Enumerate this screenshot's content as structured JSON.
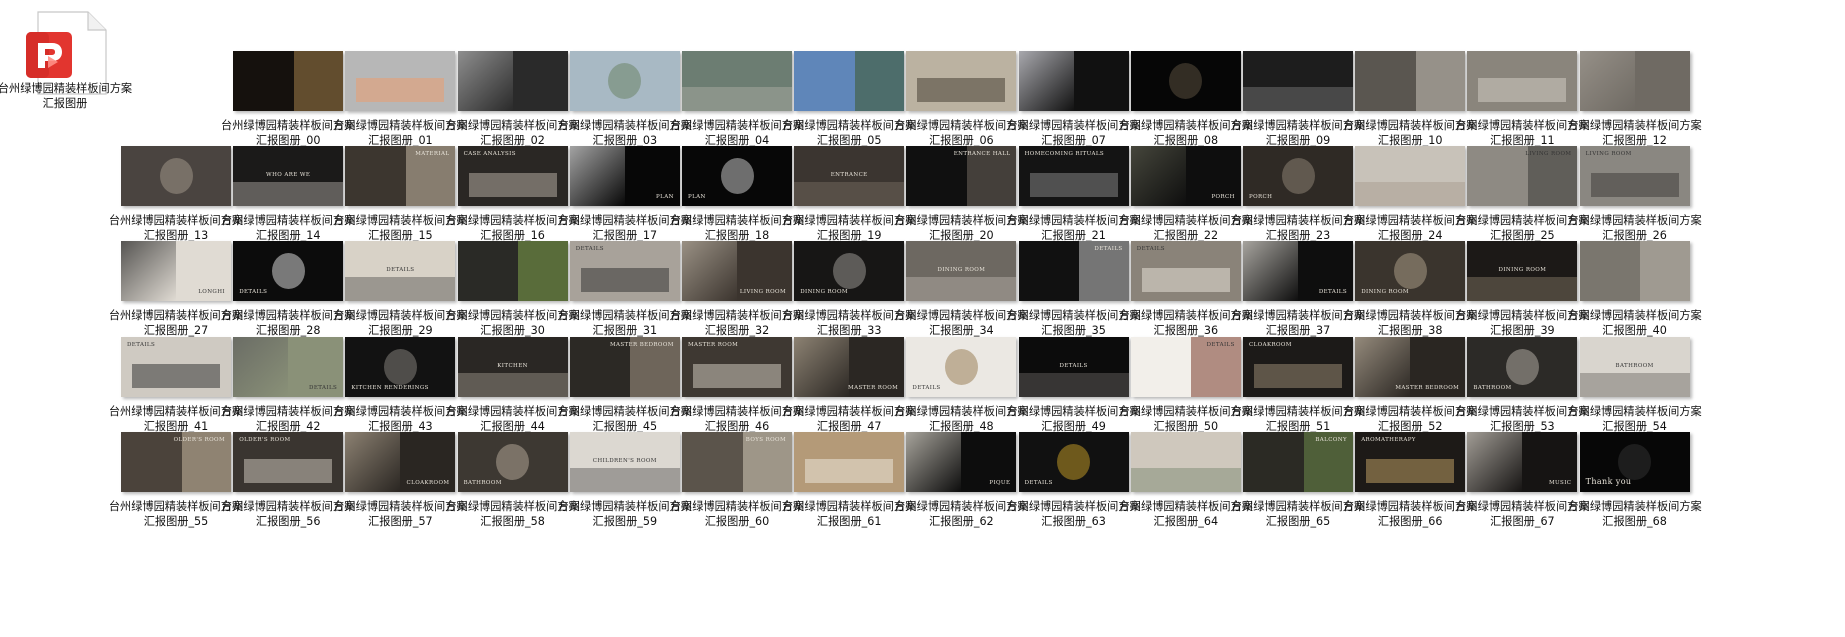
{
  "title_prefix": "台州绿博园精装样板间方案汇报图册",
  "file_item": {
    "label": "台州绿博园精装样板间方案汇报图册",
    "icon": "pdf-file-icon"
  },
  "items": [
    {
      "label": "台州绿博园精装样板间方案汇报图册_00",
      "bg": "#15110d",
      "accent": "#a37f4a",
      "text": "",
      "tone": "dark"
    },
    {
      "label": "台州绿博园精装样板间方案汇报图册_01",
      "bg": "#b7b7b7",
      "accent": "#f09b6a",
      "text": "",
      "tone": "light"
    },
    {
      "label": "台州绿博园精装样板间方案汇报图册_02",
      "bg": "#2a2a2a",
      "accent": "#b9b9b9",
      "text": "",
      "tone": "dark"
    },
    {
      "label": "台州绿博园精装样板间方案汇报图册_03",
      "bg": "#a8b9c4",
      "accent": "#5f7a54",
      "text": "",
      "tone": "light"
    },
    {
      "label": "台州绿博园精装样板间方案汇报图册_04",
      "bg": "#6c7d72",
      "accent": "#c7c1b6",
      "text": "",
      "tone": "light"
    },
    {
      "label": "台州绿博园精装样板间方案汇报图册_05",
      "bg": "#5f86b9",
      "accent": "#3e5a2c",
      "text": "",
      "tone": "light"
    },
    {
      "label": "台州绿博园精装样板间方案汇报图册_06",
      "bg": "#bbb2a1",
      "accent": "#3e352c",
      "text": "",
      "tone": "light"
    },
    {
      "label": "台州绿博园精装样板间方案汇报图册_07",
      "bg": "#111111",
      "accent": "#e9e9f0",
      "text": "",
      "tone": "dark"
    },
    {
      "label": "台州绿博园精装样板间方案汇报图册_08",
      "bg": "#060606",
      "accent": "#6b5e4a",
      "text": "",
      "tone": "dark"
    },
    {
      "label": "台州绿博园精装样板间方案汇报图册_09",
      "bg": "#1d1d1d",
      "accent": "#9a9a9a",
      "text": "",
      "tone": "dark"
    },
    {
      "label": "台州绿博园精装样板间方案汇报图册_10",
      "bg": "#5a5650",
      "accent": "#c9c3b8",
      "text": "",
      "tone": "dark"
    },
    {
      "label": "台州绿博园精装样板间方案汇报图册_11",
      "bg": "#8a857c",
      "accent": "#d6d1c8",
      "text": "",
      "tone": "light"
    },
    {
      "label": "台州绿博园精装样板间方案汇报图册_12",
      "bg": "#6f6a63",
      "accent": "#a6a097",
      "text": "",
      "tone": "light"
    },
    {
      "label": "台州绿博园精装样板间方案汇报图册_13",
      "bg": "#4a4440",
      "accent": "#b1a796",
      "text": "",
      "tone": "dark"
    },
    {
      "label": "台州绿博园精装样板间方案汇报图册_14",
      "bg": "#1b1a19",
      "accent": "#e1dcd4",
      "text": "WHO ARE WE",
      "tone": "dark"
    },
    {
      "label": "台州绿博园精装样板间方案汇报图册_15",
      "bg": "#3c362f",
      "accent": "#c4b8a4",
      "text": "MATERIAL",
      "tone": "dark"
    },
    {
      "label": "台州绿博园精装样板间方案汇报图册_16",
      "bg": "#2a2724",
      "accent": "#bdb6a9",
      "text": "CASE ANALYSIS",
      "tone": "dark"
    },
    {
      "label": "台州绿博园精装样板间方案汇报图册_17",
      "bg": "#070707",
      "accent": "#e6e6e6",
      "text": "PLAN",
      "tone": "dark"
    },
    {
      "label": "台州绿博园精装样板间方案汇报图册_18",
      "bg": "#070707",
      "accent": "#ededed",
      "text": "PLAN",
      "tone": "dark"
    },
    {
      "label": "台州绿博园精装样板间方案汇报图册_19",
      "bg": "#3b3530",
      "accent": "#8b8074",
      "text": "ENTRANCE",
      "tone": "dark"
    },
    {
      "label": "台州绿博园精装样板间方案汇报图册_20",
      "bg": "#101010",
      "accent": "#6f665c",
      "text": "ENTRANCE HALL",
      "tone": "dark"
    },
    {
      "label": "台州绿博园精装样板间方案汇报图册_21",
      "bg": "#141414",
      "accent": "#8c8c8c",
      "text": "HOMECOMING RITUALS",
      "tone": "dark"
    },
    {
      "label": "台州绿博园精装样板间方案汇报图册_22",
      "bg": "#0e0e0e",
      "accent": "#5d5e4f",
      "text": "PORCH",
      "tone": "dark"
    },
    {
      "label": "台州绿博园精装样板间方案汇报图册_23",
      "bg": "#2f2a25",
      "accent": "#a09382",
      "text": "PORCH",
      "tone": "dark"
    },
    {
      "label": "台州绿博园精装样板间方案汇报图册_24",
      "bg": "#c8c2b9",
      "accent": "#9a8d7d",
      "text": "",
      "tone": "light"
    },
    {
      "label": "台州绿博园精装样板间方案汇报图册_25",
      "bg": "#8e8a83",
      "accent": "#3b3a37",
      "text": "LIVING ROOM",
      "tone": "light"
    },
    {
      "label": "台州绿博园精装样板间方案汇报图册_26",
      "bg": "#8a8781",
      "accent": "#3a3835",
      "text": "LIVING ROOM",
      "tone": "light"
    },
    {
      "label": "台州绿博园精装样板间方案汇报图册_27",
      "bg": "#e0dbd3",
      "accent": "#1b1b1b",
      "text": "LONGHI",
      "tone": "light"
    },
    {
      "label": "台州绿博园精装样板间方案汇报图册_28",
      "bg": "#0c0c0c",
      "accent": "#ffffff",
      "text": "DETAILS",
      "tone": "dark"
    },
    {
      "label": "台州绿博园精装样板间方案汇报图册_29",
      "bg": "#d8d2c7",
      "accent": "#2b2b2b",
      "text": "DETAILS",
      "tone": "light"
    },
    {
      "label": "台州绿博园精装样板间方案汇报图册_30",
      "bg": "#2a2a26",
      "accent": "#7fa34a",
      "text": "",
      "tone": "dark"
    },
    {
      "label": "台州绿博园精装样板间方案汇报图册_31",
      "bg": "#a8a29a",
      "accent": "#2c2c2c",
      "text": "DETAILS",
      "tone": "light"
    },
    {
      "label": "台州绿博园精装样板间方案汇报图册_32",
      "bg": "#3b342e",
      "accent": "#c2b8a9",
      "text": "LIVING ROOM",
      "tone": "dark"
    },
    {
      "label": "台州绿博园精装样板间方案汇报图册_33",
      "bg": "#171615",
      "accent": "#b3b0aa",
      "text": "DINING ROOM",
      "tone": "dark"
    },
    {
      "label": "台州绿博园精装样板间方案汇报图册_34",
      "bg": "#6d6861",
      "accent": "#d0cbc3",
      "text": "DINING ROOM",
      "tone": "dark"
    },
    {
      "label": "台州绿博园精装样板间方案汇报图册_35",
      "bg": "#111111",
      "accent": "#c9c9c9",
      "text": "DETAILS",
      "tone": "dark"
    },
    {
      "label": "台州绿博园精装样板间方案汇报图册_36",
      "bg": "#8a8379",
      "accent": "#ece7de",
      "text": "DETAILS",
      "tone": "light"
    },
    {
      "label": "台州绿博园精装样板间方案汇报图册_37",
      "bg": "#0e0e0e",
      "accent": "#e8e4dc",
      "text": "DETAILS",
      "tone": "dark"
    },
    {
      "label": "台州绿博园精装样板间方案汇报图册_38",
      "bg": "#3a342d",
      "accent": "#c1b19a",
      "text": "DINING ROOM",
      "tone": "dark"
    },
    {
      "label": "台州绿博园精装样板间方案汇报图册_39",
      "bg": "#1c1917",
      "accent": "#aa9a82",
      "text": "DINING ROOM",
      "tone": "dark"
    },
    {
      "label": "台州绿博园精装样板间方案汇报图册_40",
      "bg": "#7a766e",
      "accent": "#bdb8ae",
      "text": "",
      "tone": "light"
    },
    {
      "label": "台州绿博园精装样板间方案汇报图册_41",
      "bg": "#cfcac2",
      "accent": "#2a2a2a",
      "text": "DETAILS",
      "tone": "light"
    },
    {
      "label": "台州绿博园精装样板间方案汇报图册_42",
      "bg": "#8a9178",
      "accent": "#5d5d5d",
      "text": "DETAILS",
      "tone": "light"
    },
    {
      "label": "台州绿博园精装样板间方案汇报图册_43",
      "bg": "#121212",
      "accent": "#9b9690",
      "text": "KITCHEN RENDERINGS",
      "tone": "dark"
    },
    {
      "label": "台州绿博园精装样板间方案汇报图册_44",
      "bg": "#2a2724",
      "accent": "#c6bcae",
      "text": "KITCHEN",
      "tone": "dark"
    },
    {
      "label": "台州绿博园精装样板间方案汇报图册_45",
      "bg": "#2c2925",
      "accent": "#a59886",
      "text": "MASTER BEDROOM",
      "tone": "dark"
    },
    {
      "label": "台州绿博园精装样板间方案汇报图册_46",
      "bg": "#3e3832",
      "accent": "#d8d1c6",
      "text": "MASTER ROOM",
      "tone": "dark"
    },
    {
      "label": "台州绿博园精装样板间方案汇报图册_47",
      "bg": "#2b2723",
      "accent": "#b6a995",
      "text": "MASTER ROOM",
      "tone": "dark"
    },
    {
      "label": "台州绿博园精装样板间方案汇报图册_48",
      "bg": "#ebe8e3",
      "accent": "#8a6a3a",
      "text": "DETAILS",
      "tone": "light"
    },
    {
      "label": "台州绿博园精装样板间方案汇报图册_49",
      "bg": "#0c0c0c",
      "accent": "#8a8580",
      "text": "DETAILS",
      "tone": "dark"
    },
    {
      "label": "台州绿博园精装样板间方案汇报图册_50",
      "bg": "#f2efea",
      "accent": "#7a3a2a",
      "text": "DETAILS",
      "tone": "light"
    },
    {
      "label": "台州绿博园精装样板间方案汇报图册_51",
      "bg": "#1c1a18",
      "accent": "#9f8f78",
      "text": "CLOAKROOM",
      "tone": "dark"
    },
    {
      "label": "台州绿博园精装样板间方案汇报图册_52",
      "bg": "#2a2622",
      "accent": "#c2b5a2",
      "text": "MASTER BEDROOM",
      "tone": "dark"
    },
    {
      "label": "台州绿博园精装样板间方案汇报图册_53",
      "bg": "#2c2a27",
      "accent": "#cac4ba",
      "text": "BATHROOM",
      "tone": "dark"
    },
    {
      "label": "台州绿博园精装样板间方案汇报图册_54",
      "bg": "#d9d5ce",
      "accent": "#4b4741",
      "text": "BATHROOM",
      "tone": "light"
    },
    {
      "label": "台州绿博园精装样板间方案汇报图册_55",
      "bg": "#4b433b",
      "accent": "#c9b8a0",
      "text": "OLDER'S ROOM",
      "tone": "dark"
    },
    {
      "label": "台州绿博园精装样板间方案汇报图册_56",
      "bg": "#3a3530",
      "accent": "#d6cfc4",
      "text": "OLDER'S ROOM",
      "tone": "dark"
    },
    {
      "label": "台州绿博园精装样板间方案汇报图册_57",
      "bg": "#2a2622",
      "accent": "#b6a894",
      "text": "CLOAKROOM",
      "tone": "dark"
    },
    {
      "label": "台州绿博园精装样板间方案汇报图册_58",
      "bg": "#3d3832",
      "accent": "#c8bba8",
      "text": "BATHROOM",
      "tone": "dark"
    },
    {
      "label": "台州绿博园精装样板间方案汇报图册_59",
      "bg": "#dcd8d1",
      "accent": "#2e2e2e",
      "text": "CHILDREN'S ROOM",
      "tone": "light"
    },
    {
      "label": "台州绿博园精装样板间方案汇报图册_60",
      "bg": "#5b544b",
      "accent": "#d6ccbc",
      "text": "BOYS ROOM",
      "tone": "dark"
    },
    {
      "label": "台州绿博园精装样板间方案汇报图册_61",
      "bg": "#b49a78",
      "accent": "#f0ebe2",
      "text": "",
      "tone": "light"
    },
    {
      "label": "台州绿博园精装样板间方案汇报图册_62",
      "bg": "#0d0d0d",
      "accent": "#e9e4d8",
      "text": "PIQUE",
      "tone": "dark"
    },
    {
      "label": "台州绿博园精装样板间方案汇报图册_63",
      "bg": "#111111",
      "accent": "#e0b12b",
      "text": "DETAILS",
      "tone": "dark"
    },
    {
      "label": "台州绿博园精装样板间方案汇报图册_64",
      "bg": "#cfc8bd",
      "accent": "#5a6f52",
      "text": "",
      "tone": "light"
    },
    {
      "label": "台州绿博园精装样板间方案汇报图册_65",
      "bg": "#2b2a24",
      "accent": "#6e8a4a",
      "text": "BALCONY",
      "tone": "dark"
    },
    {
      "label": "台州绿博园精装样板间方案汇报图册_66",
      "bg": "#1d1a17",
      "accent": "#c9a86a",
      "text": "AROMATHERAPY",
      "tone": "dark"
    },
    {
      "label": "台州绿博园精装样板间方案汇报图册_67",
      "bg": "#161413",
      "accent": "#ddd7cd",
      "text": "MUSIC",
      "tone": "dark"
    },
    {
      "label": "台州绿博园精装样板间方案汇报图册_68",
      "bg": "#070707",
      "accent": "#3a3a3a",
      "text": "Thank you",
      "tone": "dark"
    }
  ]
}
